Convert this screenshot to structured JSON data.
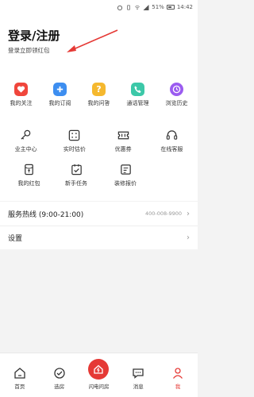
{
  "status_bar": {
    "battery": "51%",
    "time": "14:42"
  },
  "header": {
    "login_title": "登录/注册",
    "login_subtitle": "登录立即领红包"
  },
  "quick_row": [
    {
      "label": "我的关注",
      "icon": "heart-icon",
      "color": "#f0463c"
    },
    {
      "label": "我的订阅",
      "icon": "plus-icon",
      "color": "#3d8ef0"
    },
    {
      "label": "我的问答",
      "icon": "question-icon",
      "color": "#f5b82e"
    },
    {
      "label": "通话管理",
      "icon": "phone-icon",
      "color": "#3cc8a8"
    },
    {
      "label": "浏览历史",
      "icon": "clock-icon",
      "color": "#9b5cf0"
    }
  ],
  "service_row1": [
    {
      "label": "业主中心",
      "icon": "key-icon"
    },
    {
      "label": "实时估价",
      "icon": "calculator-icon"
    },
    {
      "label": "优惠券",
      "icon": "coupon-icon"
    },
    {
      "label": "在线客服",
      "icon": "headset-icon"
    }
  ],
  "service_row2": [
    {
      "label": "我的红包",
      "icon": "red-packet-icon"
    },
    {
      "label": "新手任务",
      "icon": "task-icon"
    },
    {
      "label": "装修报价",
      "icon": "quote-icon"
    }
  ],
  "hotline": {
    "label": "服务热线 (9:00-21:00)",
    "number": "400-008-9900"
  },
  "settings": {
    "label": "设置"
  },
  "bottom_nav": [
    {
      "label": "首页",
      "icon": "home-icon"
    },
    {
      "label": "选房",
      "icon": "check-icon"
    },
    {
      "label": "闪电问房",
      "icon": "lightning-house-icon"
    },
    {
      "label": "消息",
      "icon": "message-icon"
    },
    {
      "label": "我",
      "icon": "person-icon"
    }
  ],
  "colors": {
    "accent": "#e53935"
  }
}
